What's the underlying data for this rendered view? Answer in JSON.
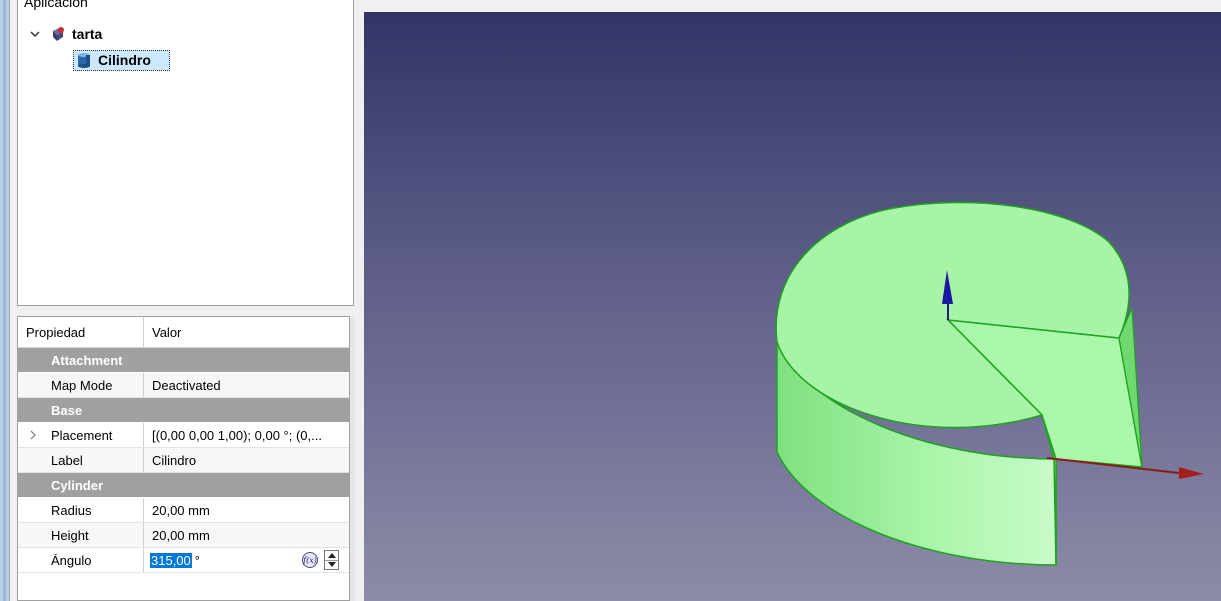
{
  "tree": {
    "header": "Aplicación",
    "document_label": "tarta",
    "object_label": "Cilindro"
  },
  "properties": {
    "col_property": "Propiedad",
    "col_value": "Valor",
    "groups": {
      "attachment": "Attachment",
      "base": "Base",
      "cylinder": "Cylinder"
    },
    "map_mode": {
      "name": "Map Mode",
      "value": "Deactivated"
    },
    "placement": {
      "name": "Placement",
      "value": "[(0,00 0,00 1,00); 0,00 °; (0,..."
    },
    "label": {
      "name": "Label",
      "value": "Cilindro"
    },
    "radius": {
      "name": "Radius",
      "value": "20,00 mm"
    },
    "height": {
      "name": "Height",
      "value": "20,00 mm"
    },
    "angle": {
      "name": "Ángulo",
      "value": "315,00",
      "unit": "°"
    }
  },
  "viewport": {
    "object_color": "#90ee90",
    "edge_color": "#1ea31e",
    "x_axis_color": "#8b1a1a",
    "z_axis_color": "#1a1a8b",
    "background_top": "#333466",
    "background_bottom": "#8c8ca8"
  },
  "icons": {
    "expand_tree": "chevron-down-icon",
    "document": "document-icon",
    "cylinder": "cylinder-icon",
    "expression": "fx-icon",
    "spin": "spinbox-arrows-icon"
  }
}
